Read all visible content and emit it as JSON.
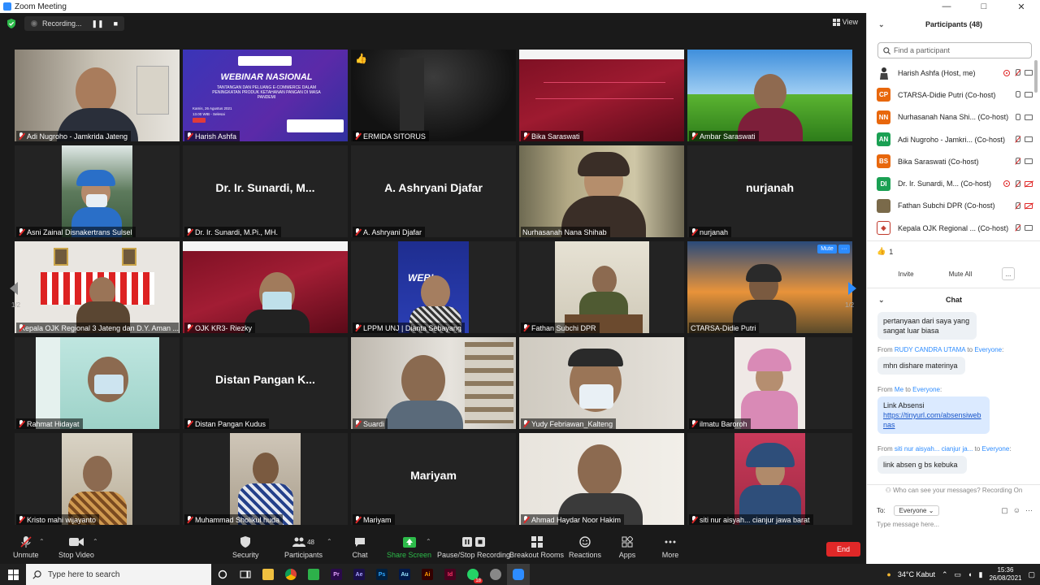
{
  "window": {
    "title": "Zoom Meeting",
    "controls": [
      "—",
      "□",
      "✕"
    ]
  },
  "topbar": {
    "recording_label": "Recording...",
    "pause": "❚❚",
    "stop": "■",
    "view_label": "View"
  },
  "pagination": {
    "left": "1/2",
    "right": "1/2"
  },
  "tiles": [
    {
      "name": "Adi Nugroho - Jamkrida Jateng",
      "big": "",
      "scene": "office"
    },
    {
      "name": "Harish Ashfa",
      "big": "",
      "scene": "webinar"
    },
    {
      "name": "ERMIDA SITORUS",
      "big": "",
      "scene": "dark"
    },
    {
      "name": "Bika Saraswati",
      "big": "",
      "scene": "maroon"
    },
    {
      "name": "Ambar Saraswati",
      "big": "",
      "scene": "field"
    },
    {
      "name": "Asni Zainal Disnakertrans Sulsel",
      "big": "",
      "scene": "mangrove"
    },
    {
      "name": "Dr. Ir. Sunardi, M.Pi., MH.",
      "big": "Dr. Ir. Sunardi, M...",
      "scene": "none"
    },
    {
      "name": "A. Ashryani Djafar",
      "big": "A. Ashryani Djafar",
      "scene": "none"
    },
    {
      "name": "Nurhasanah Nana Shihab",
      "big": "",
      "scene": "hijab"
    },
    {
      "name": "nurjanah",
      "big": "nurjanah",
      "scene": "none"
    },
    {
      "name": "Kepala OJK Regional 3 Jateng dan D.Y. Aman ...",
      "big": "",
      "scene": "flags"
    },
    {
      "name": "OJK KR3- Riezky",
      "big": "",
      "scene": "maroonperson"
    },
    {
      "name": "LPPM UNJ | Dianta Sebayang",
      "big": "",
      "scene": "unj"
    },
    {
      "name": "Fathan Subchi DPR",
      "big": "",
      "scene": "desk"
    },
    {
      "name": "CTARSA-Didie Putri",
      "big": "",
      "scene": "sunset"
    },
    {
      "name": "Rahmat Hidayat",
      "big": "",
      "scene": "teal"
    },
    {
      "name": "Distan Pangan Kudus",
      "big": "Distan Pangan K...",
      "scene": "none"
    },
    {
      "name": "Suardi",
      "big": "",
      "scene": "shelf"
    },
    {
      "name": "Yudy Febriawan_Kalteng",
      "big": "",
      "scene": "mask"
    },
    {
      "name": "ilmatu Baroroh",
      "big": "",
      "scene": "pinkhijab"
    },
    {
      "name": "Kristo mahi wijayanto",
      "big": "",
      "scene": "batik"
    },
    {
      "name": "Muhammad Sholikul huda",
      "big": "",
      "scene": "room"
    },
    {
      "name": "Mariyam",
      "big": "Mariyam",
      "scene": "none"
    },
    {
      "name": "Ahmad Haydar Noor Hakim",
      "big": "",
      "scene": "wall"
    },
    {
      "name": "siti nur aisyah... cianjur jawa barat",
      "big": "",
      "scene": "bluehijab"
    }
  ],
  "webinar_poster": {
    "headline": "WEBINAR NASIONAL",
    "sub": "TANTANGAN DAN PELUANG E-COMMERCE DALAM PENINGKATAN PRODUK KETAHANAN PANGAN DI MASA PANDEMI",
    "date": "Kamis, 26 Agustus 2021",
    "time": "13.00 WIB - Selesai"
  },
  "unj_poster_text": "WEBI",
  "tile_mute_menu": {
    "mute": "Mute",
    "more": "···"
  },
  "toolbar": {
    "unmute": "Unmute",
    "stop_video": "Stop Video",
    "security": "Security",
    "participants": "Participants",
    "participants_count": "48",
    "chat": "Chat",
    "share_screen": "Share Screen",
    "pause_stop_recording": "Pause/Stop Recording",
    "breakout_rooms": "Breakout Rooms",
    "reactions": "Reactions",
    "apps": "Apps",
    "more": "More",
    "end": "End"
  },
  "sidebar": {
    "participants_title": "Participants (48)",
    "search_placeholder": "Find a participant",
    "participants": [
      {
        "initials": "",
        "name": "Harish Ashfa (Host, me)",
        "color": "#6b6b6b",
        "icons": "rec"
      },
      {
        "initials": "CP",
        "name": "CTARSA-Didie Putri (Co-host)",
        "color": "#e8670c",
        "icons": "mic"
      },
      {
        "initials": "NN",
        "name": "Nurhasanah Nana Shi...  (Co-host)",
        "color": "#e8670c",
        "icons": "mic"
      },
      {
        "initials": "AN",
        "name": "Adi Nugroho - Jamkri...  (Co-host)",
        "color": "#1aa053",
        "icons": "mute"
      },
      {
        "initials": "BS",
        "name": "Bika Saraswati (Co-host)",
        "color": "#e8670c",
        "icons": "mute"
      },
      {
        "initials": "DI",
        "name": "Dr. Ir. Sunardi, M...  (Co-host)",
        "color": "#1aa053",
        "icons": "recmute"
      },
      {
        "initials": "",
        "name": "Fathan Subchi DPR (Co-host)",
        "color": "#7a6a4a",
        "icons": "mutecam"
      },
      {
        "initials": "",
        "name": "Kepala OJK Regional ...  (Co-host)",
        "color": "#c0392b",
        "icons": "mute"
      }
    ],
    "reaction": {
      "emoji": "👍",
      "count": "1"
    },
    "invite": "Invite",
    "mute_all": "Mute All",
    "more": "...",
    "chat_title": "Chat",
    "messages": [
      {
        "from": "",
        "to": "",
        "text": "pertanyaan dari saya yang sangat luar biasa",
        "link": "",
        "me": false
      },
      {
        "from": "RUDY CANDRA UTAMA",
        "to": "Everyone",
        "text": "mhn dishare materinya",
        "link": "",
        "me": false
      },
      {
        "from": "Me",
        "to": "Everyone",
        "text": "Link Absensi",
        "link": "https://tinyurl.com/absensiwebnas",
        "me": true
      },
      {
        "from": "siti nur aisyah... cianjur ja...",
        "to": "Everyone",
        "text": "link absen g bs kebuka",
        "link": "",
        "me": false
      }
    ],
    "from_word": "From",
    "to_word": "to",
    "who_can_see": "Who can see your messages? Recording On",
    "to_label": "To:",
    "to_value": "Everyone",
    "type_placeholder": "Type message here..."
  },
  "taskbar": {
    "search_placeholder": "Type here to search",
    "weather": "34°C  Kabut",
    "time": "15:36",
    "date": "26/08/2021",
    "notif_badge": "18",
    "apps": [
      "Pr",
      "Ae",
      "Ps",
      "Au",
      "Ai",
      "Id"
    ]
  }
}
